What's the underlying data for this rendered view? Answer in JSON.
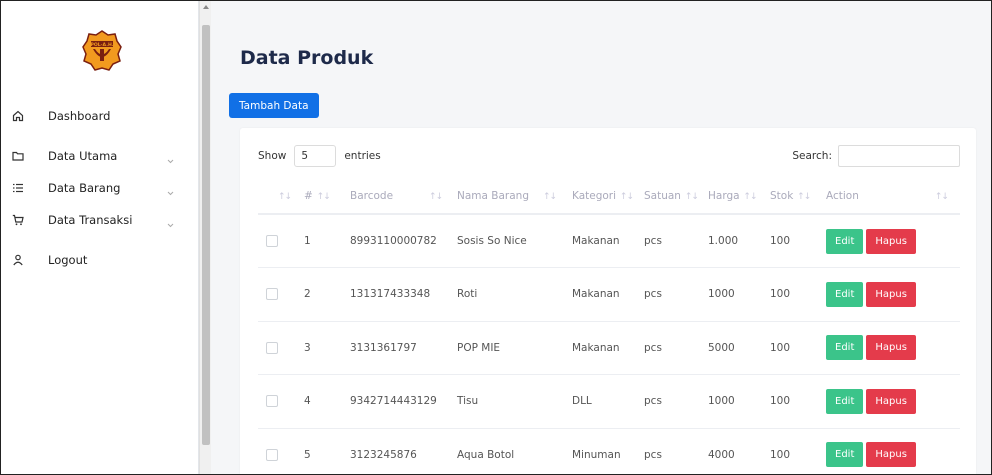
{
  "sidebar": {
    "logo_text": "POL-A.H.",
    "items": [
      {
        "label": "Dashboard",
        "icon": "home-icon",
        "chevron": false
      },
      {
        "label": "Data Utama",
        "icon": "folder-icon",
        "chevron": true
      },
      {
        "label": "Data Barang",
        "icon": "list-icon",
        "chevron": true
      },
      {
        "label": "Data Transaksi",
        "icon": "cart-icon",
        "chevron": true
      },
      {
        "label": "Logout",
        "icon": "user-icon",
        "chevron": false
      }
    ]
  },
  "main": {
    "title": "Data Produk",
    "add_button": "Tambah Data",
    "show_label": "Show",
    "show_value": "5",
    "entries_label": "entries",
    "search_label": "Search:",
    "search_value": ""
  },
  "table": {
    "headers": [
      "#",
      "Barcode",
      "Nama Barang",
      "Kategori",
      "Satuan",
      "Harga",
      "Stok",
      "Action"
    ],
    "rows": [
      {
        "no": "1",
        "barcode": "8993110000782",
        "nama": "Sosis So Nice",
        "kategori": "Makanan",
        "satuan": "pcs",
        "harga": "1.000",
        "stok": "100"
      },
      {
        "no": "2",
        "barcode": "131317433348",
        "nama": "Roti",
        "kategori": "Makanan",
        "satuan": "pcs",
        "harga": "1000",
        "stok": "100"
      },
      {
        "no": "3",
        "barcode": "3131361797",
        "nama": "POP MIE",
        "kategori": "Makanan",
        "satuan": "pcs",
        "harga": "5000",
        "stok": "100"
      },
      {
        "no": "4",
        "barcode": "9342714443129",
        "nama": "Tisu",
        "kategori": "DLL",
        "satuan": "pcs",
        "harga": "1000",
        "stok": "100"
      },
      {
        "no": "5",
        "barcode": "3123245876",
        "nama": "Aqua Botol",
        "kategori": "Minuman",
        "satuan": "pcs",
        "harga": "4000",
        "stok": "100"
      }
    ],
    "edit_label": "Edit",
    "delete_label": "Hapus"
  },
  "colors": {
    "primary": "#1170e6",
    "success": "#3bc48a",
    "danger": "#e43b4b",
    "logo_orange": "#f29a1f",
    "logo_dark": "#7a1f10"
  }
}
